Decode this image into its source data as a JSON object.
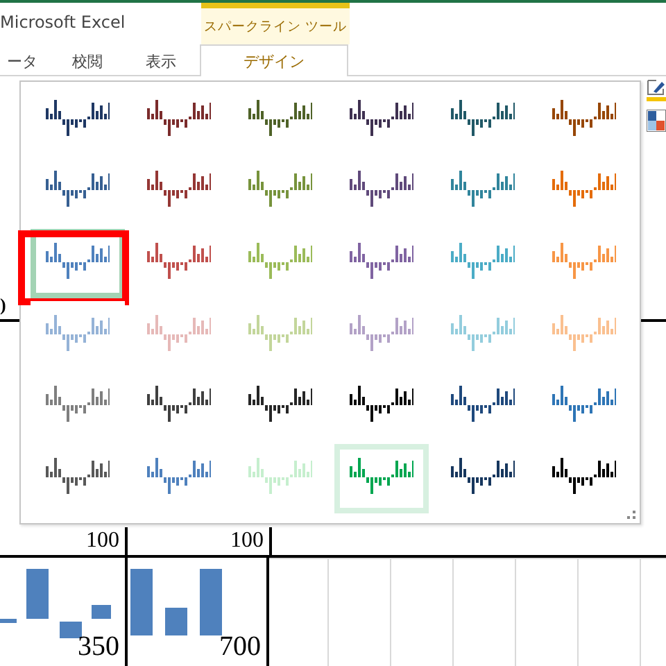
{
  "window": {
    "title": "Microsoft Excel"
  },
  "context_tab_group": {
    "label": "スパークライン ツール"
  },
  "tabs": [
    {
      "label": "ータ",
      "selected": false
    },
    {
      "label": "校閲",
      "selected": false
    },
    {
      "label": "表示",
      "selected": false
    },
    {
      "label": "デザイン",
      "selected": true
    }
  ],
  "sheet": {
    "header_fragment": ")",
    "cells": [
      {
        "value": "100"
      },
      {
        "value": "100"
      },
      {
        "value": "350"
      },
      {
        "value": "700"
      }
    ]
  },
  "style_gallery": {
    "items": [
      {
        "color": "#1f3864",
        "selected": false,
        "hovered": false,
        "annotated": false
      },
      {
        "color": "#7b2c2c",
        "selected": false,
        "hovered": false,
        "annotated": false
      },
      {
        "color": "#4f6228",
        "selected": false,
        "hovered": false,
        "annotated": false
      },
      {
        "color": "#3f3151",
        "selected": false,
        "hovered": false,
        "annotated": false
      },
      {
        "color": "#215967",
        "selected": false,
        "hovered": false,
        "annotated": false
      },
      {
        "color": "#974706",
        "selected": false,
        "hovered": false,
        "annotated": false
      },
      {
        "color": "#376092",
        "selected": false,
        "hovered": false,
        "annotated": false
      },
      {
        "color": "#953735",
        "selected": false,
        "hovered": false,
        "annotated": false
      },
      {
        "color": "#77933c",
        "selected": false,
        "hovered": false,
        "annotated": false
      },
      {
        "color": "#604a7b",
        "selected": false,
        "hovered": false,
        "annotated": false
      },
      {
        "color": "#31859c",
        "selected": false,
        "hovered": false,
        "annotated": false
      },
      {
        "color": "#e46c0a",
        "selected": false,
        "hovered": false,
        "annotated": false
      },
      {
        "color": "#4f81bd",
        "selected": false,
        "hovered": true,
        "annotated": true
      },
      {
        "color": "#c0504d",
        "selected": false,
        "hovered": false,
        "annotated": false
      },
      {
        "color": "#9bbb59",
        "selected": false,
        "hovered": false,
        "annotated": false
      },
      {
        "color": "#8064a2",
        "selected": false,
        "hovered": false,
        "annotated": false
      },
      {
        "color": "#4bacc6",
        "selected": false,
        "hovered": false,
        "annotated": false
      },
      {
        "color": "#f79646",
        "selected": false,
        "hovered": false,
        "annotated": false
      },
      {
        "color": "#95b3d7",
        "selected": false,
        "hovered": false,
        "annotated": false
      },
      {
        "color": "#e6b9b8",
        "selected": false,
        "hovered": false,
        "annotated": false
      },
      {
        "color": "#c3d69b",
        "selected": false,
        "hovered": false,
        "annotated": false
      },
      {
        "color": "#b3a2c7",
        "selected": false,
        "hovered": false,
        "annotated": false
      },
      {
        "color": "#93cddd",
        "selected": false,
        "hovered": false,
        "annotated": false
      },
      {
        "color": "#fac090",
        "selected": false,
        "hovered": false,
        "annotated": false
      },
      {
        "color": "#7f7f7f",
        "selected": false,
        "hovered": false,
        "annotated": false
      },
      {
        "color": "#404040",
        "selected": false,
        "hovered": false,
        "annotated": false
      },
      {
        "color": "#262626",
        "selected": false,
        "hovered": false,
        "annotated": false
      },
      {
        "color": "#0d0d0d",
        "selected": false,
        "hovered": false,
        "annotated": false
      },
      {
        "color": "#1f497d",
        "selected": false,
        "hovered": false,
        "annotated": false
      },
      {
        "color": "#2e75b6",
        "selected": false,
        "hovered": false,
        "annotated": false
      },
      {
        "color": "#595959",
        "selected": false,
        "hovered": false,
        "annotated": false
      },
      {
        "color": "#4f81bd",
        "selected": false,
        "hovered": false,
        "annotated": false
      },
      {
        "color": "#c6efce",
        "selected": false,
        "hovered": false,
        "annotated": false
      },
      {
        "color": "#00a650",
        "selected": true,
        "hovered": false,
        "annotated": false
      },
      {
        "color": "#17375e",
        "selected": false,
        "hovered": false,
        "annotated": false
      },
      {
        "color": "#000000",
        "selected": false,
        "hovered": false,
        "annotated": false
      }
    ]
  }
}
